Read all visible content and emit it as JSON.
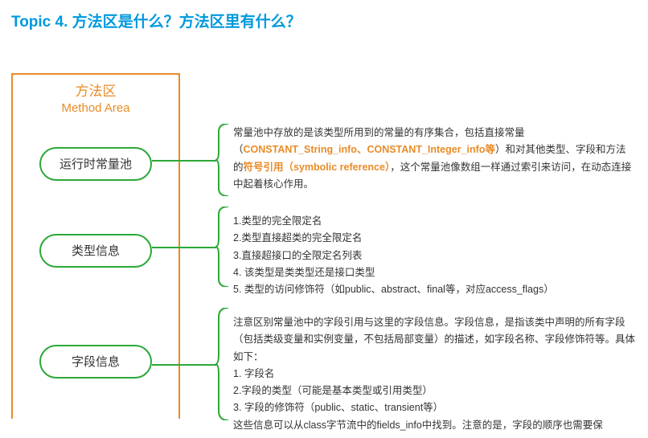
{
  "title": "Topic 4. 方法区是什么？方法区里有什么？",
  "methodArea": {
    "cn": "方法区",
    "en": "Method Area"
  },
  "pills": {
    "p1": "运行时常量池",
    "p2": "类型信息",
    "p3": "字段信息"
  },
  "desc1": {
    "t1": "常量池中存放的是该类型所用到的常量的有序集合，包括直接常量（",
    "h1": "CONSTANT_String_info、CONSTANT_Integer_info等",
    "t2": "）和对其他类型、字段和方法的",
    "h2": "符号引用（symbolic reference）",
    "t3": "，这个常量池像数组一样通过索引来访问，在动态连接中起着核心作用。"
  },
  "desc2": {
    "l1": "1.类型的完全限定名",
    "l2": "2.类型直接超类的完全限定名",
    "l3": "3.直接超接口的全限定名列表",
    "l4": "4. 该类型是类类型还是接口类型",
    "l5": "5. 类型的访问修饰符（如public、abstract、final等，对应access_flags）"
  },
  "desc3": {
    "t1": "注意区别常量池中的字段引用与这里的字段信息。字段信息，是指该类中声明的所有字段（包括类级变量和实例变量，不包括局部变量）的描述，如字段名称、字段修饰符等。具体如下：",
    "l1": "1. 字段名",
    "l2": "2.字段的类型（可能是基本类型或引用类型）",
    "l3": "3. 字段的修饰符（public、static、transient等）",
    "t2": "这些信息可以从class字节流中的fields_info中找到。注意的是，字段的顺序也需要保"
  }
}
